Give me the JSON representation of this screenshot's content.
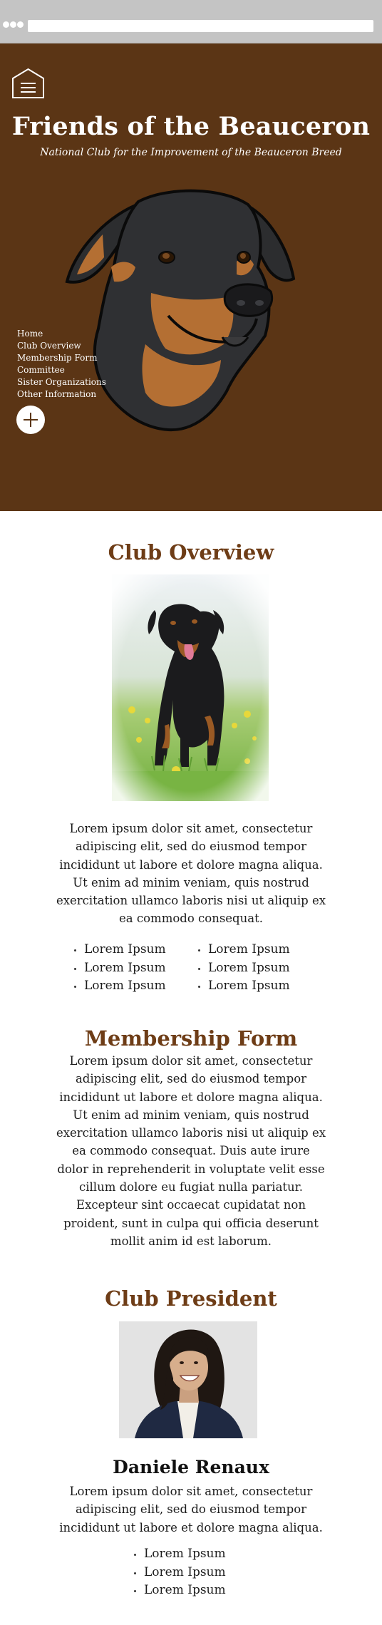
{
  "site": {
    "title": "Friends of the Beauceron",
    "subtitle": "National Club for the Improvement of the Beauceron Breed"
  },
  "nav": {
    "items": [
      {
        "label": "Home"
      },
      {
        "label": "Club Overview"
      },
      {
        "label": "Membership Form"
      },
      {
        "label": "Committee"
      },
      {
        "label": "Sister Organizations"
      },
      {
        "label": "Other Information"
      }
    ]
  },
  "icons": {
    "menu": "home-menu-icon",
    "expand": "plus-icon"
  },
  "colors": {
    "hero_background": "#5b3515",
    "heading": "#6e3d17",
    "text": "#1c1c1c"
  },
  "overview": {
    "title": "Club Overview",
    "text": "Lorem ipsum dolor sit amet, consectetur adipiscing elit, sed do eiusmod tempor incididunt ut labore et dolore magna aliqua. Ut enim ad minim veniam, quis nostrud exercitation ullamco laboris nisi ut aliquip ex ea commodo consequat.",
    "list_left": [
      "Lorem Ipsum",
      "Lorem Ipsum",
      "Lorem Ipsum"
    ],
    "list_right": [
      "Lorem Ipsum",
      "Lorem Ipsum",
      "Lorem Ipsum"
    ]
  },
  "membership": {
    "title": "Membership Form",
    "text": "Lorem ipsum dolor sit amet, consectetur adipiscing elit, sed do eiusmod tempor incididunt ut labore et dolore magna aliqua. Ut enim ad minim veniam, quis nostrud exercitation ullamco laboris nisi ut aliquip ex ea commodo consequat. Duis aute irure dolor in reprehenderit in voluptate velit esse cillum dolore eu fugiat nulla pariatur. Excepteur sint occaecat cupidatat non proident, sunt in culpa qui officia deserunt mollit anim id est laborum."
  },
  "president": {
    "title": "Club President",
    "name": "Daniele Renaux",
    "text": "Lorem ipsum dolor sit amet, consectetur adipiscing elit, sed do eiusmod tempor incididunt ut labore et dolore magna aliqua.",
    "list": [
      "Lorem Ipsum",
      "Lorem Ipsum",
      "Lorem Ipsum"
    ]
  }
}
